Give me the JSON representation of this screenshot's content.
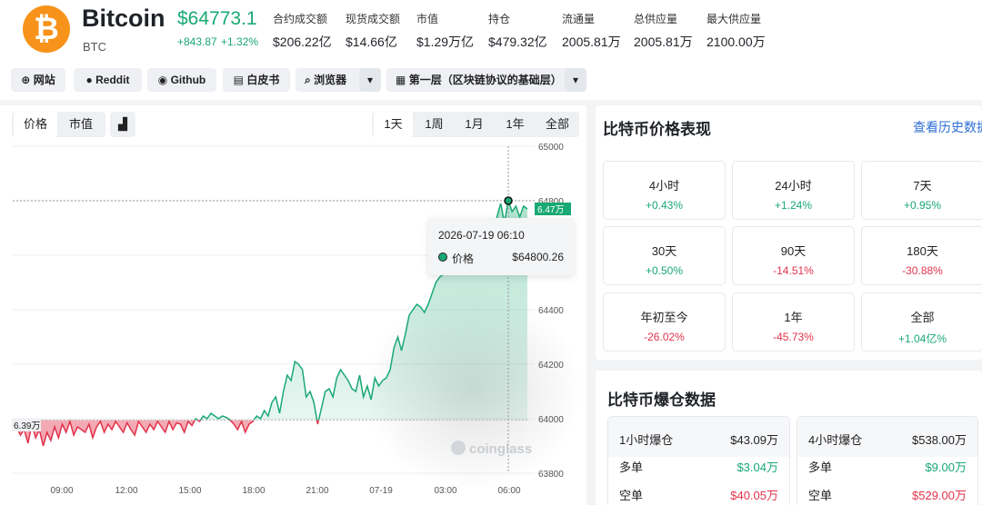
{
  "coin": {
    "logo_glyph": "₿",
    "name": "Bitcoin",
    "symbol": "BTC",
    "price": "$64773.1",
    "change_abs": "+843.87",
    "change_pct": "+1.32%",
    "accent": "#19a974",
    "brand": "#f7931a"
  },
  "stats": [
    {
      "label": "合约成交额",
      "value": "$206.22亿"
    },
    {
      "label": "现货成交额",
      "value": "$14.66亿"
    },
    {
      "label": "市值",
      "value": "$1.29万亿"
    },
    {
      "label": "持仓",
      "value": "$479.32亿"
    },
    {
      "label": "流通量",
      "value": "2005.81万"
    },
    {
      "label": "总供应量",
      "value": "2005.81万"
    },
    {
      "label": "最大供应量",
      "value": "2100.00万"
    }
  ],
  "links": {
    "website": "网站",
    "reddit": "Reddit",
    "github": "Github",
    "whitepaper": "白皮书",
    "explorer": "浏览器",
    "category": "第一层（区块链协议的基础层）"
  },
  "chart_controls": {
    "price_tab": "价格",
    "mcap_tab": "市值",
    "ranges": [
      "1天",
      "1周",
      "1月",
      "1年",
      "全部"
    ],
    "active_range": "1天"
  },
  "chart_data": {
    "type": "area",
    "ylim": [
      63800,
      65000
    ],
    "yticks": [
      "65000",
      "64800",
      "64600",
      "64400",
      "64200",
      "64000",
      "63800"
    ],
    "xticks": [
      "09:00",
      "12:00",
      "15:00",
      "18:00",
      "21:00",
      "07-19",
      "03:00",
      "06:00"
    ],
    "baseline": 63995,
    "baseline_label": "6.39万",
    "current_label": "6.47万",
    "watermark": "coinglass",
    "values": [
      63990,
      63970,
      63940,
      63960,
      63910,
      63980,
      63930,
      63960,
      63900,
      63950,
      63920,
      63970,
      63930,
      63980,
      63950,
      63990,
      63940,
      63970,
      63960,
      63950,
      63980,
      63930,
      63970,
      63990,
      63950,
      63980,
      63960,
      63990,
      63970,
      63950,
      63985,
      63960,
      63940,
      63990,
      63970,
      63950,
      63980,
      63960,
      63990,
      63970,
      63950,
      63990,
      63960,
      63985,
      63980,
      63950,
      63990,
      63975,
      64000,
      63990,
      64010,
      64000,
      64020,
      64010,
      64000,
      64010,
      64005,
      63995,
      63980,
      63960,
      63990,
      63950,
      63980,
      63990,
      64010,
      64000,
      64030,
      64010,
      64060,
      64080,
      64020,
      64100,
      64160,
      64140,
      64210,
      64200,
      64180,
      64080,
      64100,
      64060,
      63980,
      64040,
      64100,
      64110,
      64080,
      64150,
      64180,
      64160,
      64140,
      64110,
      64100,
      64160,
      64080,
      64120,
      64070,
      64150,
      64120,
      64140,
      64150,
      64180,
      64260,
      64300,
      64250,
      64310,
      64380,
      64400,
      64420,
      64410,
      64390,
      64420,
      64460,
      64500,
      64520,
      64530,
      64560,
      64550,
      64570,
      64600,
      64620,
      64580,
      64640,
      64600,
      64650,
      64700,
      64650,
      64720,
      64680,
      64740,
      64790,
      64720,
      64800,
      64760,
      64780,
      64740,
      64780,
      64770
    ],
    "tooltip": {
      "time": "2026-07-19 06:10",
      "series": "价格",
      "value": "$64800.26"
    }
  },
  "performance": {
    "title": "比特币价格表现",
    "history_link": "查看历史数据",
    "items": [
      {
        "label": "4小时",
        "value": "+0.43%",
        "dir": "up"
      },
      {
        "label": "24小时",
        "value": "+1.24%",
        "dir": "up"
      },
      {
        "label": "7天",
        "value": "+0.95%",
        "dir": "up"
      },
      {
        "label": "30天",
        "value": "+0.50%",
        "dir": "up"
      },
      {
        "label": "90天",
        "value": "-14.51%",
        "dir": "down"
      },
      {
        "label": "180天",
        "value": "-30.88%",
        "dir": "down"
      },
      {
        "label": "年初至今",
        "value": "-26.02%",
        "dir": "down"
      },
      {
        "label": "1年",
        "value": "-45.73%",
        "dir": "down"
      },
      {
        "label": "全部",
        "value": "+1.04亿%",
        "dir": "up"
      }
    ]
  },
  "liquidation": {
    "title": "比特币爆仓数据",
    "boxes": [
      {
        "header_label": "1小时爆仓",
        "header_value": "$43.09万",
        "long_label": "多单",
        "long_value": "$3.04万",
        "short_label": "空单",
        "short_value": "$40.05万"
      },
      {
        "header_label": "4小时爆仓",
        "header_value": "$538.00万",
        "long_label": "多单",
        "long_value": "$9.00万",
        "short_label": "空单",
        "short_value": "$529.00万"
      }
    ]
  }
}
